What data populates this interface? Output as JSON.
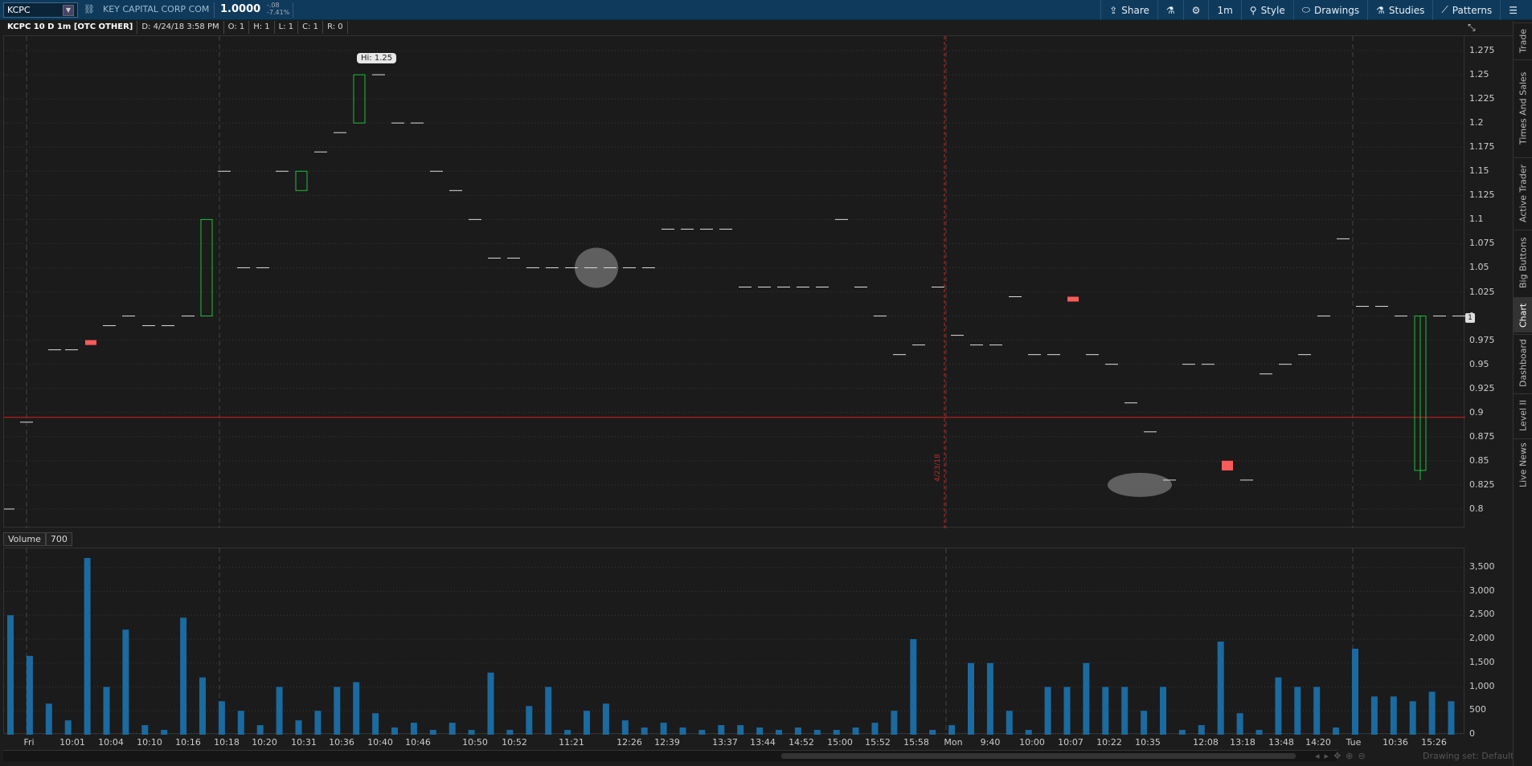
{
  "toolbar": {
    "symbol": "KCPC",
    "company": "KEY CAPITAL CORP COM",
    "price": "1.0000",
    "change": "-.08",
    "change_pct": "-7.41%",
    "buttons": [
      "Share",
      "1m",
      "Style",
      "Drawings",
      "Studies",
      "Patterns"
    ]
  },
  "infobar": {
    "title": "KCPC 10 D 1m [OTC OTHER]",
    "date": "D: 4/24/18 3:58 PM",
    "open": "O: 1",
    "high": "H: 1",
    "low": "L: 1",
    "close": "C: 1",
    "range": "R: 0"
  },
  "volume_header": {
    "label": "Volume",
    "value": "700"
  },
  "hi_bubble": "Hi: 1.25",
  "last_marker": "1",
  "date_divider": "4/23/18",
  "drawing_set": "Drawing set: Default",
  "right_tabs": [
    "Trade",
    "Times And Sales",
    "Active Trader",
    "Big Buttons",
    "Chart",
    "Dashboard",
    "Level II",
    "Live News"
  ],
  "chart_data": [
    {
      "type": "candlestick",
      "title": "KCPC 10 D 1m [OTC OTHER]",
      "y_ticks": [
        "1.275",
        "1.25",
        "1.225",
        "1.2",
        "1.175",
        "1.15",
        "1.125",
        "1.1",
        "1.075",
        "1.05",
        "1.025",
        "1",
        "0.975",
        "0.95",
        "0.925",
        "0.9",
        "0.875",
        "0.85",
        "0.825",
        "0.8"
      ],
      "ylim": [
        0.78,
        1.29
      ],
      "reference_line": 0.895,
      "bars": [
        {
          "x": 5,
          "o": 0.8,
          "c": 0.8,
          "h": 0.8,
          "l": 0.8
        },
        {
          "x": 28,
          "o": 0.89,
          "c": 0.89,
          "h": 0.89,
          "l": 0.89
        },
        {
          "x": 63,
          "o": 0.965,
          "c": 0.965,
          "h": 0.965,
          "l": 0.965
        },
        {
          "x": 84,
          "o": 0.965,
          "c": 0.965,
          "h": 0.965,
          "l": 0.965
        },
        {
          "x": 108,
          "o": 0.975,
          "c": 0.97,
          "h": 0.975,
          "l": 0.97
        },
        {
          "x": 131,
          "o": 0.99,
          "c": 0.99,
          "h": 0.99,
          "l": 0.99
        },
        {
          "x": 155,
          "o": 1.0,
          "c": 1.0,
          "h": 1.0,
          "l": 1.0
        },
        {
          "x": 180,
          "o": 0.99,
          "c": 0.99,
          "h": 0.99,
          "l": 0.99
        },
        {
          "x": 204,
          "o": 0.99,
          "c": 0.99,
          "h": 0.99,
          "l": 0.99
        },
        {
          "x": 229,
          "o": 1.0,
          "c": 1.0,
          "h": 1.01,
          "l": 1.0
        },
        {
          "x": 252,
          "o": 1.0,
          "c": 1.1,
          "h": 1.1,
          "l": 1.0
        },
        {
          "x": 274,
          "o": 1.15,
          "c": 1.15,
          "h": 1.15,
          "l": 1.15
        },
        {
          "x": 298,
          "o": 1.05,
          "c": 1.05,
          "h": 1.05,
          "l": 1.05
        },
        {
          "x": 322,
          "o": 1.05,
          "c": 1.05,
          "h": 1.05,
          "l": 1.05
        },
        {
          "x": 346,
          "o": 1.15,
          "c": 1.15,
          "h": 1.15,
          "l": 1.15
        },
        {
          "x": 370,
          "o": 1.13,
          "c": 1.15,
          "h": 1.15,
          "l": 1.13
        },
        {
          "x": 394,
          "o": 1.17,
          "c": 1.17,
          "h": 1.17,
          "l": 1.17
        },
        {
          "x": 418,
          "o": 1.19,
          "c": 1.19,
          "h": 1.19,
          "l": 1.19
        },
        {
          "x": 442,
          "o": 1.2,
          "c": 1.25,
          "h": 1.25,
          "l": 1.2
        },
        {
          "x": 466,
          "o": 1.25,
          "c": 1.25,
          "h": 1.25,
          "l": 1.25
        },
        {
          "x": 490,
          "o": 1.2,
          "c": 1.2,
          "h": 1.2,
          "l": 1.2
        },
        {
          "x": 514,
          "o": 1.2,
          "c": 1.2,
          "h": 1.2,
          "l": 1.2
        },
        {
          "x": 538,
          "o": 1.15,
          "c": 1.15,
          "h": 1.15,
          "l": 1.15
        },
        {
          "x": 562,
          "o": 1.13,
          "c": 1.13,
          "h": 1.13,
          "l": 1.13
        },
        {
          "x": 586,
          "o": 1.1,
          "c": 1.1,
          "h": 1.1,
          "l": 1.1
        },
        {
          "x": 610,
          "o": 1.06,
          "c": 1.06,
          "h": 1.06,
          "l": 1.06
        },
        {
          "x": 634,
          "o": 1.06,
          "c": 1.06,
          "h": 1.06,
          "l": 1.06
        },
        {
          "x": 658,
          "o": 1.05,
          "c": 1.05,
          "h": 1.05,
          "l": 1.05
        },
        {
          "x": 682,
          "o": 1.05,
          "c": 1.05,
          "h": 1.05,
          "l": 1.05
        },
        {
          "x": 706,
          "o": 1.05,
          "c": 1.05,
          "h": 1.05,
          "l": 1.05
        },
        {
          "x": 730,
          "o": 1.05,
          "c": 1.05,
          "h": 1.05,
          "l": 1.05
        },
        {
          "x": 754,
          "o": 1.05,
          "c": 1.05,
          "h": 1.05,
          "l": 1.05
        },
        {
          "x": 778,
          "o": 1.05,
          "c": 1.05,
          "h": 1.05,
          "l": 1.05
        },
        {
          "x": 802,
          "o": 1.05,
          "c": 1.05,
          "h": 1.05,
          "l": 1.05
        },
        {
          "x": 826,
          "o": 1.09,
          "c": 1.09,
          "h": 1.09,
          "l": 1.09
        },
        {
          "x": 850,
          "o": 1.09,
          "c": 1.09,
          "h": 1.09,
          "l": 1.09
        },
        {
          "x": 874,
          "o": 1.09,
          "c": 1.09,
          "h": 1.09,
          "l": 1.09
        },
        {
          "x": 898,
          "o": 1.09,
          "c": 1.09,
          "h": 1.09,
          "l": 1.09
        },
        {
          "x": 922,
          "o": 1.03,
          "c": 1.03,
          "h": 1.03,
          "l": 1.03
        },
        {
          "x": 946,
          "o": 1.03,
          "c": 1.03,
          "h": 1.03,
          "l": 1.03
        },
        {
          "x": 970,
          "o": 1.03,
          "c": 1.03,
          "h": 1.03,
          "l": 1.03
        },
        {
          "x": 994,
          "o": 1.03,
          "c": 1.03,
          "h": 1.03,
          "l": 1.03
        },
        {
          "x": 1018,
          "o": 1.03,
          "c": 1.03,
          "h": 1.03,
          "l": 1.03
        },
        {
          "x": 1042,
          "o": 1.1,
          "c": 1.1,
          "h": 1.1,
          "l": 1.1
        },
        {
          "x": 1066,
          "o": 1.03,
          "c": 1.03,
          "h": 1.03,
          "l": 1.03
        },
        {
          "x": 1090,
          "o": 1.0,
          "c": 1.0,
          "h": 1.0,
          "l": 1.0
        },
        {
          "x": 1114,
          "o": 0.96,
          "c": 0.96,
          "h": 0.96,
          "l": 0.96
        },
        {
          "x": 1138,
          "o": 0.97,
          "c": 0.97,
          "h": 0.97,
          "l": 0.97
        },
        {
          "x": 1162,
          "o": 1.03,
          "c": 1.03,
          "h": 1.03,
          "l": 1.03
        },
        {
          "x": 1186,
          "o": 0.98,
          "c": 0.98,
          "h": 0.98,
          "l": 0.98
        },
        {
          "x": 1210,
          "o": 0.97,
          "c": 0.97,
          "h": 0.97,
          "l": 0.97
        },
        {
          "x": 1234,
          "o": 0.97,
          "c": 0.97,
          "h": 0.97,
          "l": 0.97
        },
        {
          "x": 1258,
          "o": 1.02,
          "c": 1.02,
          "h": 1.02,
          "l": 1.02
        },
        {
          "x": 1282,
          "o": 0.96,
          "c": 0.96,
          "h": 0.96,
          "l": 0.96
        },
        {
          "x": 1306,
          "o": 0.96,
          "c": 0.96,
          "h": 0.96,
          "l": 0.96
        },
        {
          "x": 1330,
          "o": 1.02,
          "c": 1.015,
          "h": 1.02,
          "l": 1.015
        },
        {
          "x": 1354,
          "o": 0.96,
          "c": 0.96,
          "h": 0.96,
          "l": 0.96
        },
        {
          "x": 1378,
          "o": 0.95,
          "c": 0.95,
          "h": 0.95,
          "l": 0.95
        },
        {
          "x": 1402,
          "o": 0.91,
          "c": 0.91,
          "h": 0.91,
          "l": 0.91
        },
        {
          "x": 1426,
          "o": 0.88,
          "c": 0.88,
          "h": 0.88,
          "l": 0.88
        },
        {
          "x": 1450,
          "o": 0.83,
          "c": 0.83,
          "h": 0.83,
          "l": 0.83
        },
        {
          "x": 1474,
          "o": 0.95,
          "c": 0.95,
          "h": 0.95,
          "l": 0.95
        },
        {
          "x": 1498,
          "o": 0.95,
          "c": 0.95,
          "h": 0.95,
          "l": 0.95
        },
        {
          "x": 1522,
          "o": 0.85,
          "c": 0.84,
          "h": 0.85,
          "l": 0.84
        },
        {
          "x": 1546,
          "o": 0.83,
          "c": 0.83,
          "h": 0.83,
          "l": 0.83
        },
        {
          "x": 1570,
          "o": 0.94,
          "c": 0.94,
          "h": 0.94,
          "l": 0.94
        },
        {
          "x": 1594,
          "o": 0.95,
          "c": 0.95,
          "h": 0.95,
          "l": 0.95
        },
        {
          "x": 1618,
          "o": 0.96,
          "c": 0.96,
          "h": 0.96,
          "l": 0.96
        },
        {
          "x": 1642,
          "o": 1.0,
          "c": 1.0,
          "h": 1.0,
          "l": 1.0
        },
        {
          "x": 1666,
          "o": 1.08,
          "c": 1.08,
          "h": 1.08,
          "l": 1.08
        },
        {
          "x": 1690,
          "o": 1.01,
          "c": 1.01,
          "h": 1.01,
          "l": 1.01
        },
        {
          "x": 1714,
          "o": 1.01,
          "c": 1.01,
          "h": 1.01,
          "l": 1.01
        },
        {
          "x": 1738,
          "o": 1.0,
          "c": 1.0,
          "h": 1.0,
          "l": 1.0
        },
        {
          "x": 1762,
          "o": 0.84,
          "c": 1.0,
          "h": 1.0,
          "l": 0.83
        },
        {
          "x": 1786,
          "o": 1.0,
          "c": 1.0,
          "h": 1.0,
          "l": 1.0
        },
        {
          "x": 1810,
          "o": 1.0,
          "c": 1.0,
          "h": 1.0,
          "l": 1.0
        }
      ]
    },
    {
      "type": "bar",
      "title": "Volume",
      "y_ticks": [
        "3,500",
        "3,000",
        "2,500",
        "2,000",
        "1,500",
        "1,000",
        "500",
        "0"
      ],
      "ylim": [
        0,
        3900
      ],
      "volumes": [
        2500,
        1650,
        650,
        300,
        3700,
        1000,
        2200,
        200,
        100,
        2450,
        1200,
        700,
        500,
        200,
        1000,
        300,
        500,
        1000,
        1100,
        450,
        150,
        250,
        100,
        250,
        100,
        1300,
        100,
        600,
        1000,
        100,
        500,
        650,
        300,
        150,
        250,
        150,
        100,
        200,
        200,
        150,
        100,
        150,
        100,
        100,
        150,
        250,
        500,
        2000,
        100,
        200,
        1500,
        1500,
        500,
        100,
        1000,
        1000,
        1500,
        1000,
        1000,
        500,
        1000,
        100,
        200,
        1950,
        450,
        100,
        1200,
        1000,
        1000,
        150,
        1800,
        800,
        800,
        700,
        900,
        700
      ]
    }
  ],
  "time_ticks": [
    "Fri",
    "10:01",
    "10:04",
    "10:10",
    "10:16",
    "10:18",
    "10:20",
    "10:31",
    "10:36",
    "10:40",
    "10:46",
    "10:50",
    "10:52",
    "11:21",
    "12:26",
    "12:39",
    "13:37",
    "13:44",
    "14:52",
    "15:00",
    "15:52",
    "15:58",
    "Mon",
    "9:40",
    "10:00",
    "10:07",
    "10:22",
    "10:35",
    "12:08",
    "13:18",
    "13:48",
    "14:20",
    "Tue",
    "10:36",
    "15:26"
  ],
  "colors": {
    "up": "#1fbf3a",
    "down": "#ff5a5a",
    "ref_line": "#d62020",
    "volume": "#1b6aa0",
    "toolbar": "#0f3a5c"
  }
}
